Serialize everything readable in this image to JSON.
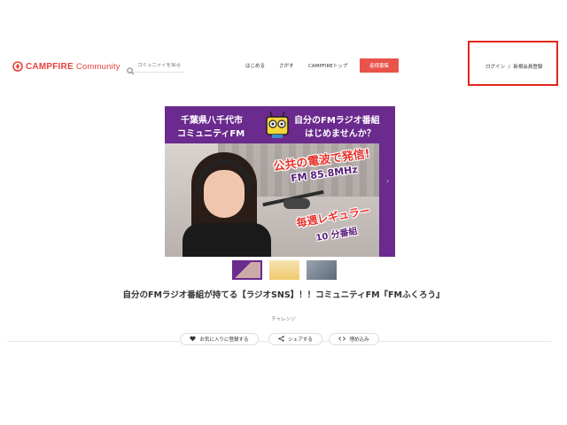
{
  "header": {
    "logo_main": "CAMPFIRE",
    "logo_sub": "Community",
    "search_placeholder": "コミュニティを探る",
    "nav": [
      "はじめる",
      "さがす",
      "CAMPFIREトップ"
    ],
    "cta_label": "者様募集",
    "login_label": "ログイン",
    "separator": "/",
    "signup_label": "新規会員登録"
  },
  "banner": {
    "line1": "千葉県八千代市",
    "line2": "コミュニティFM",
    "line3": "自分のFMラジオ番組",
    "line4": "はじめませんか？",
    "callout1": "公共の電波で発信!",
    "callout2": "FM 85.8MHz",
    "callout3": "毎週レギュラー",
    "callout4": "10 分番組"
  },
  "thumbnails": [
    {
      "label": "",
      "active": true
    },
    {
      "label": "",
      "active": false
    },
    {
      "label": "",
      "active": false
    }
  ],
  "project": {
    "title": "自分のFMラジオ番組が持てる【ラジオSNS】！！コミュニティFM『FMふくろう』",
    "owner": "チャレンジ"
  },
  "actions": {
    "favorite_label": "お気に入りに登録する",
    "share_label": "シェアする",
    "embed_label": "埋め込み"
  },
  "colors": {
    "brand": "#e6433b",
    "highlight_box": "#e1261c",
    "banner_purple": "#6b2a8d"
  }
}
